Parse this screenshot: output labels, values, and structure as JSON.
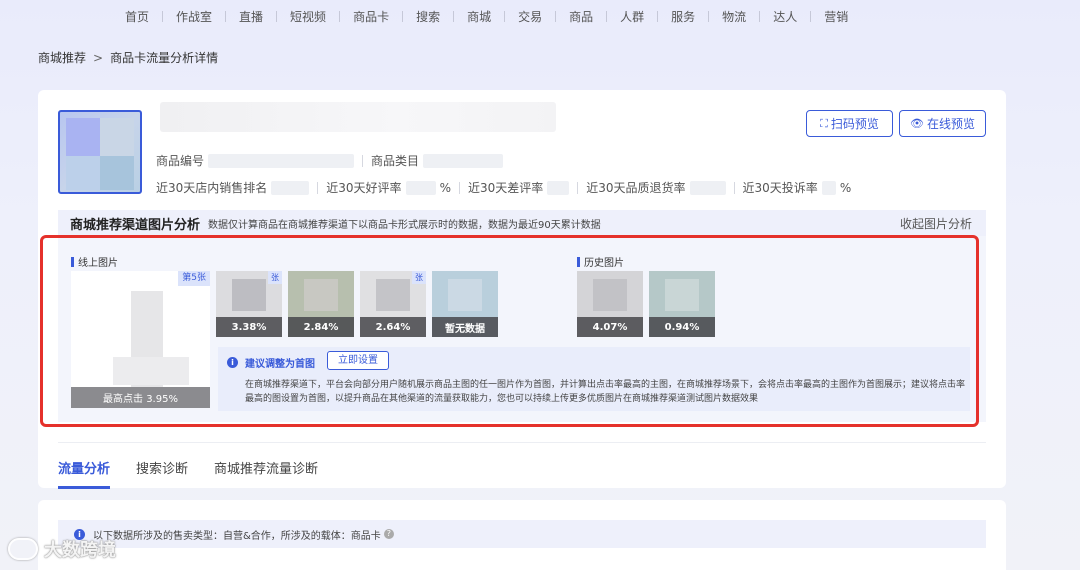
{
  "nav": {
    "items": [
      "首页",
      "作战室",
      "直播",
      "短视频",
      "商品卡",
      "搜索",
      "商城",
      "交易",
      "商品",
      "人群",
      "服务",
      "物流",
      "达人",
      "营销"
    ]
  },
  "breadcrumb": {
    "parent": "商城推荐",
    "separator": ">",
    "current": "商品卡流量分析详情"
  },
  "product": {
    "code_label": "商品编号",
    "category_label": "商品类目",
    "sales_rank_label": "近30天店内销售排名",
    "good_rate_label": "近30天好评率",
    "good_rate_unit": "%",
    "bad_rate_label": "近30天差评率",
    "quality_return_label": "近30天品质退货率",
    "complaint_label": "近30天投诉率",
    "complaint_unit": "%"
  },
  "buttons": {
    "scan_preview": "扫码预览",
    "online_preview": "在线预览"
  },
  "image_analysis": {
    "title": "商城推荐渠道图片分析",
    "desc": "数据仅计算商品在商城推荐渠道下以商品卡形式展示时的数据，数据为最近90天累计数据",
    "collapse": "收起图片分析",
    "online_label": "线上图片",
    "history_label": "历史图片",
    "main_image": {
      "badge": "第5张",
      "caption": "最高点击 3.95%"
    },
    "online_images": [
      {
        "badge": "张",
        "value": "3.38%"
      },
      {
        "badge": "",
        "value": "2.84%"
      },
      {
        "badge": "张",
        "value": "2.64%"
      },
      {
        "badge": "",
        "value": "暂无数据"
      }
    ],
    "history_images": [
      {
        "value": "4.07%"
      },
      {
        "value": "0.94%"
      }
    ],
    "advice": {
      "title": "建议调整为首图",
      "button": "立即设置",
      "text": "在商城推荐渠道下，平台会向部分用户随机展示商品主图的任一图片作为首图，并计算出点击率最高的主图，在商城推荐场景下，会将点击率最高的主图作为首图展示；建议将点击率最高的图设置为首图，以提升商品在其他渠道的流量获取能力，您也可以持续上传更多优质图片在商城推荐渠道测试图片数据效果"
    }
  },
  "tabs": [
    "流量分析",
    "搜索诊断",
    "商城推荐流量诊断"
  ],
  "notice": {
    "text": "以下数据所涉及的售卖类型：自营&合作，所涉及的载体：商品卡"
  },
  "watermark": "大数跨境",
  "colors": {
    "accent": "#3a5bd9",
    "highlight_border": "#e5312b"
  }
}
